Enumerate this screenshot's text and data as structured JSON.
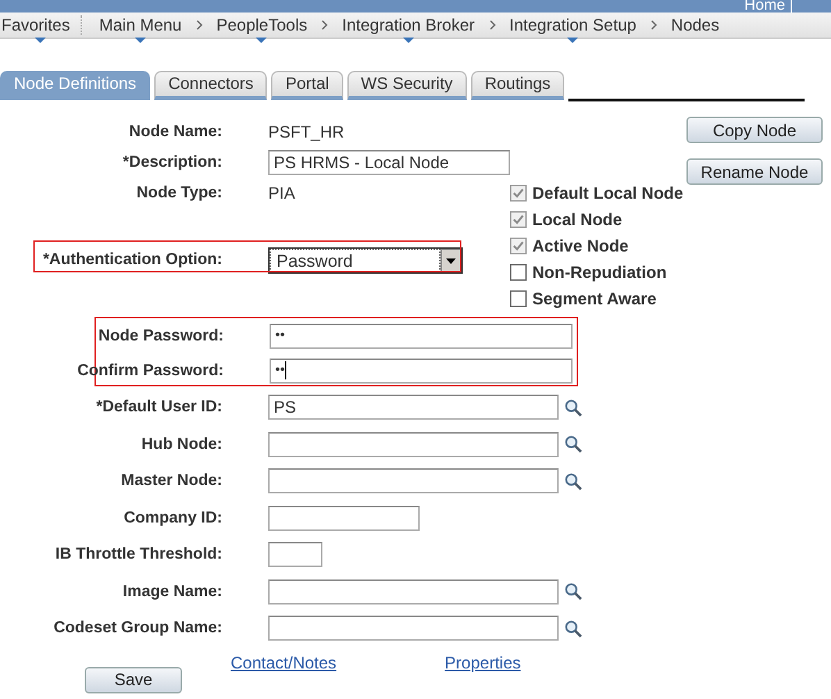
{
  "header": {
    "home_link": "Home"
  },
  "breadcrumbs": [
    {
      "label": "Favorites",
      "has_menu": true
    },
    {
      "label": "Main Menu",
      "has_menu": true
    },
    {
      "label": "PeopleTools",
      "has_menu": true
    },
    {
      "label": "Integration Broker",
      "has_menu": true
    },
    {
      "label": "Integration Setup",
      "has_menu": true
    },
    {
      "label": "Nodes",
      "has_menu": false
    }
  ],
  "tabs": [
    {
      "label": "Node Definitions",
      "selected": true
    },
    {
      "label": "Connectors",
      "selected": false
    },
    {
      "label": "Portal",
      "selected": false
    },
    {
      "label": "WS Security",
      "selected": false
    },
    {
      "label": "Routings",
      "selected": false
    }
  ],
  "top_fields": [
    {
      "label": "Node Name:",
      "kind": "static",
      "value": "PSFT_HR"
    },
    {
      "label": "*Description:",
      "kind": "text",
      "value": "PS HRMS - Local Node"
    },
    {
      "label": "Node Type:",
      "kind": "static",
      "value": "PIA"
    },
    {
      "label": "*Authentication Option:",
      "kind": "select",
      "value": "Password",
      "highlighted": true
    }
  ],
  "checkboxes": [
    {
      "label": "Default Local Node",
      "checked": true,
      "disabled": true
    },
    {
      "label": "Local Node",
      "checked": true,
      "disabled": true
    },
    {
      "label": "Active Node",
      "checked": true,
      "disabled": true
    },
    {
      "label": "Non-Repudiation",
      "checked": false,
      "disabled": false
    },
    {
      "label": "Segment Aware",
      "checked": false,
      "disabled": false
    }
  ],
  "side_buttons": [
    "Copy Node",
    "Rename Node"
  ],
  "password_fields": [
    {
      "label": "Node Password:",
      "value": "••",
      "focused": false
    },
    {
      "label": "Confirm Password:",
      "value": "••",
      "focused": true
    }
  ],
  "fields": [
    {
      "label": "*Default User ID:",
      "kind": "wide",
      "value": "PS",
      "lookup": true
    },
    {
      "label": "Hub Node:",
      "kind": "wide",
      "lookup": true
    },
    {
      "label": "Master Node:",
      "kind": "wide",
      "lookup": true
    },
    {
      "label": "Company ID:",
      "kind": "medium",
      "lookup": false
    },
    {
      "label": "IB Throttle Threshold:",
      "kind": "narrow",
      "lookup": false
    },
    {
      "label": "Image Name:",
      "kind": "wide",
      "lookup": true
    },
    {
      "label": "Codeset Group Name:",
      "kind": "wide",
      "lookup": true
    }
  ],
  "links": [
    "Contact/Notes",
    "Properties"
  ],
  "save_button": "Save"
}
